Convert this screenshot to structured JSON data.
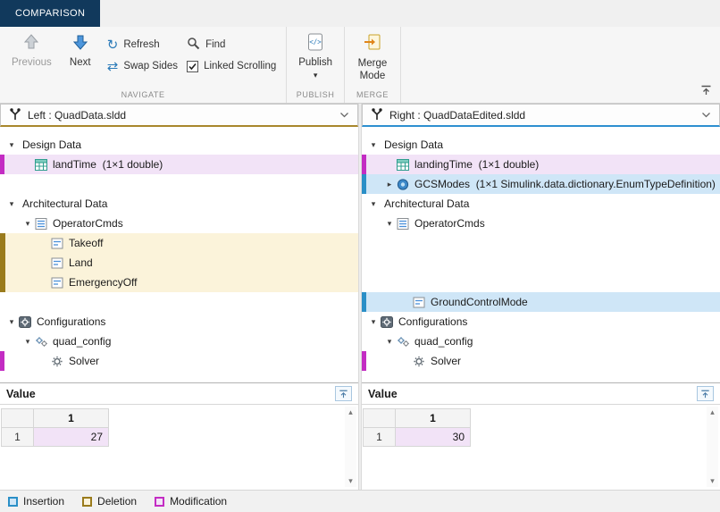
{
  "tab": {
    "label": "COMPARISON"
  },
  "toolbar": {
    "previous": {
      "label": "Previous",
      "enabled": false
    },
    "next": {
      "label": "Next",
      "enabled": true
    },
    "refresh": {
      "label": "Refresh"
    },
    "swap_sides": {
      "label": "Swap Sides"
    },
    "find": {
      "label": "Find"
    },
    "linked_scrolling": {
      "label": "Linked Scrolling",
      "checked": true
    },
    "publish": {
      "label": "Publish"
    },
    "merge_mode": {
      "line1": "Merge",
      "line2": "Mode"
    },
    "groups": {
      "navigate": "NAVIGATE",
      "publish": "PUBLISH",
      "merge": "MERGE"
    }
  },
  "panels": {
    "left": {
      "title": "Left : QuadData.sldd",
      "accent": "#a8872c",
      "tree": [
        {
          "label": "Design Data",
          "indent": 0,
          "expander": "open",
          "icon": "none"
        },
        {
          "label": "landTime  (1×1 double)",
          "indent": 1,
          "icon": "table",
          "highlight": "modification"
        },
        {
          "spacer": true
        },
        {
          "label": "Architectural Data",
          "indent": 0,
          "expander": "open",
          "icon": "none"
        },
        {
          "label": "OperatorCmds",
          "indent": 1,
          "expander": "open",
          "icon": "list"
        },
        {
          "label": "Takeoff",
          "indent": 2,
          "icon": "field",
          "highlight": "deletion"
        },
        {
          "label": "Land",
          "indent": 2,
          "icon": "field",
          "highlight": "deletion"
        },
        {
          "label": "EmergencyOff",
          "indent": 2,
          "icon": "field",
          "highlight": "deletion"
        },
        {
          "spacer": true
        },
        {
          "label": "Configurations",
          "indent": 0,
          "expander": "open",
          "icon": "config"
        },
        {
          "label": "quad_config",
          "indent": 1,
          "expander": "open",
          "icon": "gears"
        },
        {
          "label": "Solver",
          "indent": 2,
          "icon": "gear",
          "bar": "modification"
        }
      ],
      "value": {
        "header": "Value",
        "col_header": "1",
        "row_header": "1",
        "cell": "27",
        "cell_highlight": "modification"
      }
    },
    "right": {
      "title": "Right : QuadDataEdited.sldd",
      "accent": "#2e8fd0",
      "tree": [
        {
          "label": "Design Data",
          "indent": 0,
          "expander": "open",
          "icon": "none"
        },
        {
          "label": "landingTime  (1×1 double)",
          "indent": 1,
          "icon": "table",
          "highlight": "modification"
        },
        {
          "label": "GCSModes  (1×1 Simulink.data.dictionary.EnumTypeDefinition)",
          "indent": 1,
          "expander": "closed",
          "icon": "enum",
          "highlight": "insertion"
        },
        {
          "label": "Architectural Data",
          "indent": 0,
          "expander": "open",
          "icon": "none"
        },
        {
          "label": "OperatorCmds",
          "indent": 1,
          "expander": "open",
          "icon": "list"
        },
        {
          "spacer": true
        },
        {
          "spacer": true
        },
        {
          "spacer": true
        },
        {
          "label": "GroundControlMode",
          "indent": 2,
          "icon": "field",
          "highlight": "insertion"
        },
        {
          "label": "Configurations",
          "indent": 0,
          "expander": "open",
          "icon": "config"
        },
        {
          "label": "quad_config",
          "indent": 1,
          "expander": "open",
          "icon": "gears"
        },
        {
          "label": "Solver",
          "indent": 2,
          "icon": "gear",
          "bar": "modification"
        }
      ],
      "value": {
        "header": "Value",
        "col_header": "1",
        "row_header": "1",
        "cell": "30",
        "cell_highlight": "modification"
      }
    }
  },
  "legend": {
    "items": [
      {
        "label": "Insertion",
        "type": "insertion"
      },
      {
        "label": "Deletion",
        "type": "deletion"
      },
      {
        "label": "Modification",
        "type": "modification"
      }
    ]
  },
  "colors": {
    "insertion_bg": "#cfe6f7",
    "insertion_border": "#2a8fc7",
    "deletion_bg": "#fbf3da",
    "deletion_border": "#9a7b1c",
    "modification_bg": "#f2e3f7",
    "modification_border": "#c32cc3",
    "tab_bg": "#11395c"
  }
}
